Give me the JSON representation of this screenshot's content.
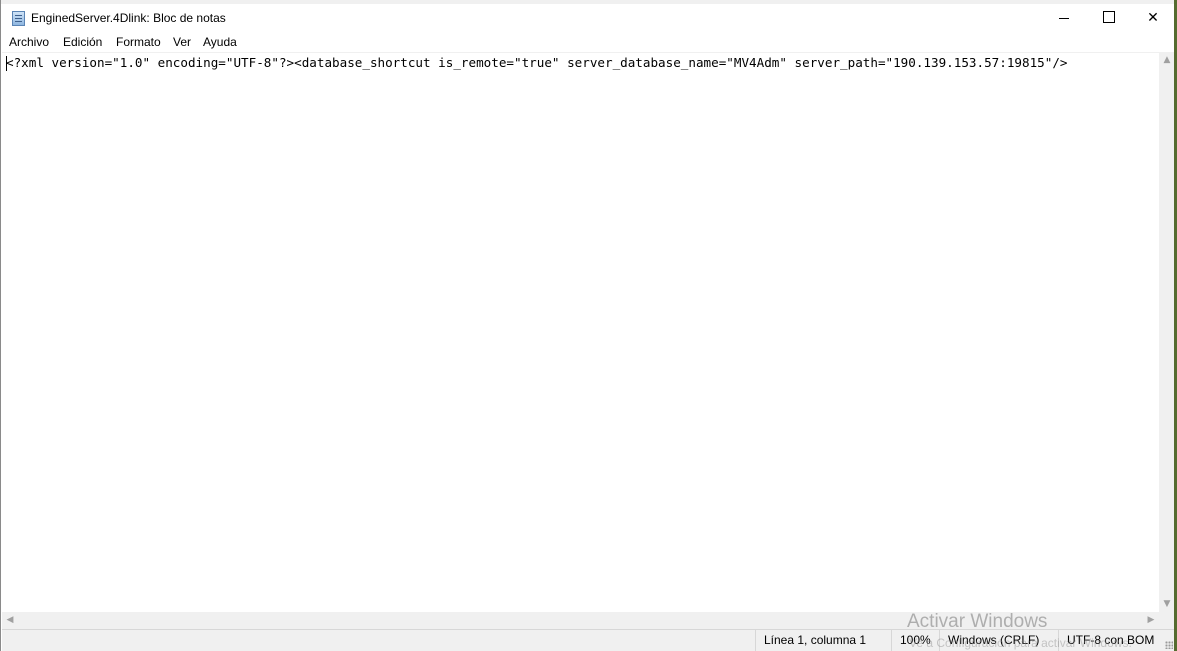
{
  "window": {
    "title": "EnginedServer.4Dlink: Bloc de notas",
    "minimize_glyph": "—",
    "close_glyph": "✕"
  },
  "menu": {
    "items": [
      "Archivo",
      "Edición",
      "Formato",
      "Ver",
      "Ayuda"
    ]
  },
  "editor": {
    "content": "<?xml version=\"1.0\" encoding=\"UTF-8\"?><database_shortcut is_remote=\"true\" server_database_name=\"MV4Adm\" server_path=\"190.139.153.57:19815\"/>"
  },
  "scrollbars": {
    "up_glyph": "▲",
    "down_glyph": "▼",
    "left_glyph": "◀",
    "right_glyph": "▶"
  },
  "status": {
    "position": "Línea 1, columna 1",
    "zoom": "100%",
    "line_endings": "Windows (CRLF)",
    "encoding": "UTF-8 con BOM"
  },
  "watermark": {
    "title": "Activar Windows",
    "subtitle": "Ve a Configuración para activar Windows."
  },
  "icons": {
    "app": "notepad-icon",
    "minimize": "minimize-icon",
    "maximize": "maximize-icon",
    "close": "close-icon"
  }
}
